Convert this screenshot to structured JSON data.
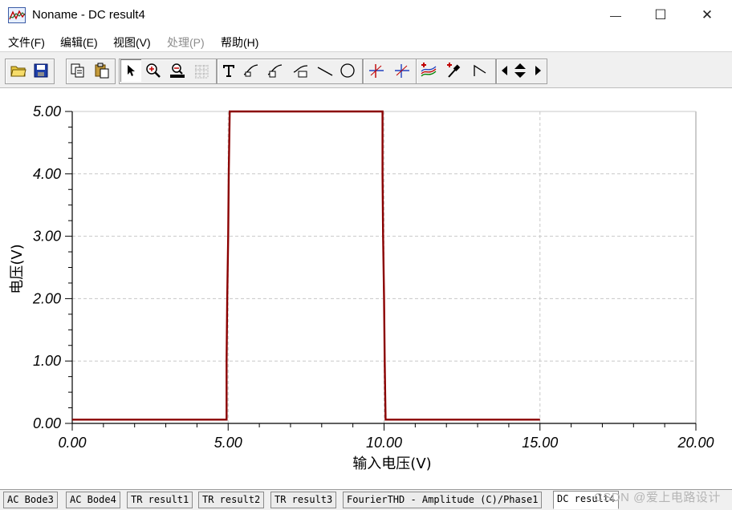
{
  "window": {
    "title": "Noname - DC result4",
    "minimize_glyph": "—",
    "maximize_glyph": "☐",
    "close_glyph": "✕"
  },
  "menu": [
    {
      "label": "文件(F)",
      "enabled": true
    },
    {
      "label": "编辑(E)",
      "enabled": true
    },
    {
      "label": "视图(V)",
      "enabled": true
    },
    {
      "label": "处理(P)",
      "enabled": false
    },
    {
      "label": "帮助(H)",
      "enabled": true
    }
  ],
  "toolbar": {
    "buttons": [
      {
        "icon": "open-folder-icon"
      },
      {
        "icon": "save-icon"
      },
      {
        "icon": "copy-icon"
      },
      {
        "icon": "paste-icon"
      },
      {
        "icon": "pointer-icon",
        "pressed": true
      },
      {
        "icon": "zoom-in-icon"
      },
      {
        "icon": "zoom-100-icon"
      },
      {
        "icon": "grid-icon"
      },
      {
        "icon": "text-tool-icon"
      },
      {
        "icon": "curve-label-icon"
      },
      {
        "icon": "curve-query-icon"
      },
      {
        "icon": "line-label-icon"
      },
      {
        "icon": "line-icon"
      },
      {
        "icon": "circle-icon"
      },
      {
        "icon": "cursor-a-icon"
      },
      {
        "icon": "cursor-b-icon"
      },
      {
        "icon": "add-curve-icon"
      },
      {
        "icon": "probe-icon"
      },
      {
        "icon": "step-icon"
      },
      {
        "icon": "scroll-left-icon"
      },
      {
        "icon": "scroll-updown-icon"
      },
      {
        "icon": "scroll-right-icon"
      }
    ]
  },
  "colors": {
    "curve": "#8b0000",
    "grid": "#c8c8c8",
    "axis": "#000000"
  },
  "chart_data": {
    "type": "line",
    "xlabel": "输入电压(V)",
    "ylabel": "电压(V)",
    "xlim": [
      0,
      20
    ],
    "ylim": [
      0,
      5
    ],
    "x_ticks": [
      "0.00",
      "5.00",
      "10.00",
      "15.00",
      "20.00"
    ],
    "y_ticks": [
      "0.00",
      "1.00",
      "2.00",
      "3.00",
      "4.00",
      "5.00"
    ],
    "grid": true,
    "series": [
      {
        "x": [
          0,
          4.95,
          4.95,
          4.97,
          5.0,
          5.02,
          5.05,
          5.05,
          9.95,
          9.95,
          9.97,
          10.0,
          10.02,
          10.05,
          10.05,
          15.0
        ],
        "y": [
          0.06,
          0.06,
          1.0,
          2.0,
          3.0,
          4.0,
          5.0,
          5.0,
          5.0,
          4.0,
          3.0,
          2.0,
          1.0,
          0.06,
          0.06,
          0.06
        ]
      }
    ]
  },
  "tabs": [
    {
      "label": "AC Bode3",
      "active": false
    },
    {
      "label": "AC Bode4",
      "active": false
    },
    {
      "label": "TR result1",
      "active": false
    },
    {
      "label": "TR result2",
      "active": false
    },
    {
      "label": "TR result3",
      "active": false
    },
    {
      "label": "FourierTHD - Amplitude (C)/Phase1",
      "active": false
    },
    {
      "label": "DC result4",
      "active": true
    }
  ],
  "watermark": "CSDN @爱上电路设计"
}
